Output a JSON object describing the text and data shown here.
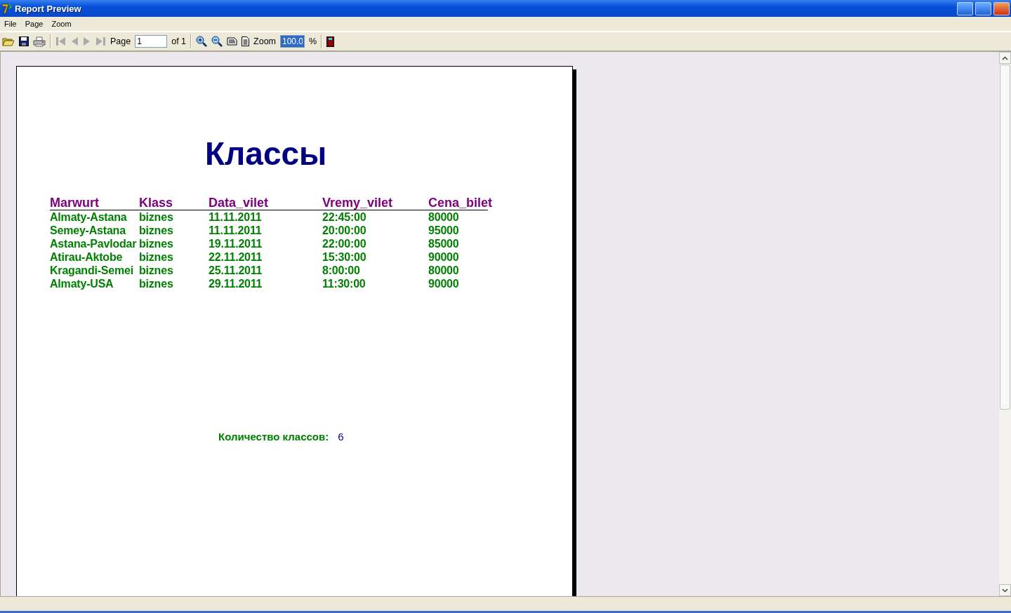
{
  "window": {
    "title": "Report Preview"
  },
  "menu": [
    "File",
    "Page",
    "Zoom"
  ],
  "toolbar": {
    "page_label": "Page",
    "page_value": "1",
    "page_of": "of 1",
    "zoom_label": "Zoom",
    "zoom_value": "100.0",
    "zoom_unit": "%"
  },
  "report": {
    "title": "Классы",
    "columns": [
      "Marwurt",
      "Klass",
      "Data_vilet",
      "Vremy_vilet",
      "Cena_bilet"
    ],
    "rows": [
      [
        "Almaty-Astana",
        "biznes",
        "11.11.2011",
        "22:45:00",
        "80000"
      ],
      [
        "Semey-Astana",
        "biznes",
        "11.11.2011",
        "20:00:00",
        "95000"
      ],
      [
        "Astana-Pavlodar",
        "biznes",
        "19.11.2011",
        "22:00:00",
        "85000"
      ],
      [
        "Atirau-Aktobe",
        "biznes",
        "22.11.2011",
        "15:30:00",
        "90000"
      ],
      [
        "Kragandi-Semei",
        "biznes",
        "25.11.2011",
        "8:00:00",
        "80000"
      ],
      [
        "Almaty-USA",
        "biznes",
        "29.11.2011",
        "11:30:00",
        "90000"
      ]
    ],
    "summary_label": "Количество классов:",
    "summary_value": "6"
  }
}
